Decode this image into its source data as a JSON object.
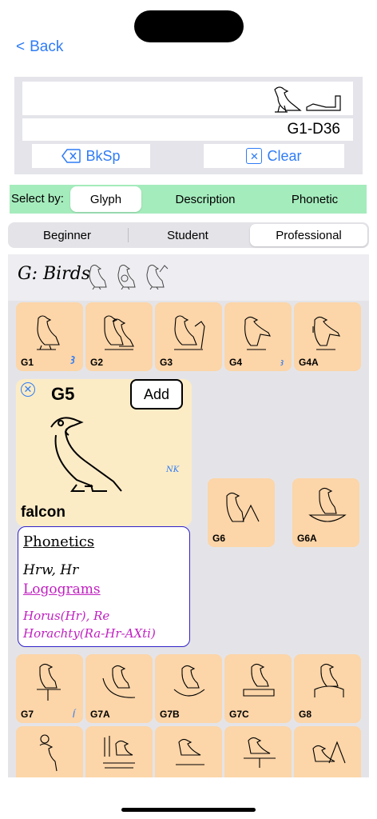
{
  "nav": {
    "back_label": "Back"
  },
  "input": {
    "code_text": "G1-D36",
    "backspace_label": "BkSp",
    "clear_label": "Clear"
  },
  "select_by": {
    "label": "Select by:",
    "options": [
      "Glyph",
      "Description",
      "Phonetic"
    ],
    "selected": "Glyph"
  },
  "level": {
    "options": [
      "Beginner",
      "Student",
      "Professional"
    ],
    "selected": "Professional"
  },
  "category": {
    "title": "G: Birds"
  },
  "tiles": {
    "row1": [
      {
        "code": "G1",
        "note": "ꜣ"
      },
      {
        "code": "G2",
        "note": ""
      },
      {
        "code": "G3",
        "note": ""
      },
      {
        "code": "G4",
        "note": "ꜣ"
      },
      {
        "code": "G4A",
        "note": ""
      }
    ],
    "row2": [
      {
        "code": "G6"
      },
      {
        "code": "G6A"
      }
    ],
    "row3": [
      {
        "code": "G7",
        "note": "Í"
      },
      {
        "code": "G7A",
        "note": ""
      },
      {
        "code": "G7B",
        "note": ""
      },
      {
        "code": "G7C",
        "note": ""
      },
      {
        "code": "G8",
        "note": ""
      }
    ]
  },
  "detail": {
    "code": "G5",
    "add_label": "Add",
    "era": "NK",
    "name": "falcon",
    "phonetics_heading": "Phonetics",
    "phonetics_value": "Hrw, Hr",
    "logograms_heading": "Logograms",
    "logograms_value": "Horus(Hr), Re Horachty(Ra-Hr-AXti)"
  },
  "colors": {
    "accent": "#2f7cf6",
    "tile": "#fcd5a8",
    "detail_bg": "#fcecc6",
    "select_bg": "#a5ecbd",
    "logogram": "#c020c0"
  }
}
